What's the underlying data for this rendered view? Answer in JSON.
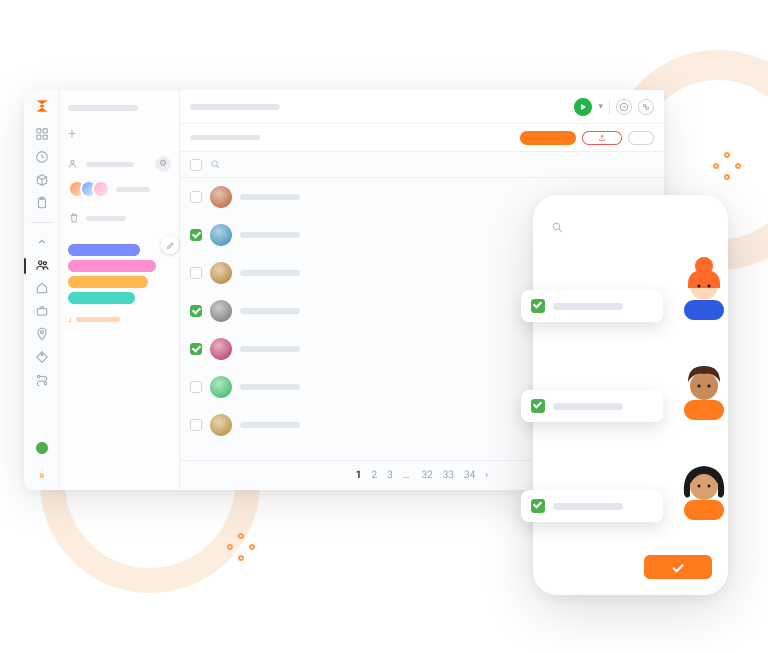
{
  "rail": {
    "logo": "S",
    "icons": [
      "dashboard",
      "clock",
      "cube",
      "clipboard",
      "chevron-up",
      "users",
      "home",
      "briefcase",
      "location",
      "tag",
      "route"
    ],
    "active_index": 5
  },
  "leftcol": {
    "sections": [
      {
        "icon": "user-group",
        "label": ""
      },
      {
        "icon": "trash",
        "label": ""
      }
    ],
    "avatars_count": 3,
    "tags": [
      {
        "color": "#7b8cff"
      },
      {
        "color": "#ff8fcf"
      },
      {
        "color": "#ffb84f"
      },
      {
        "color": "#46d6c4"
      }
    ],
    "sort_label": ""
  },
  "toolbar": {
    "title_placeholder": "",
    "buttons": {
      "play": "",
      "history": "",
      "settings": ""
    }
  },
  "subtoolbar": {
    "crumb": "",
    "primary_label": "",
    "share_label": "",
    "more_label": ""
  },
  "list": {
    "search_placeholder": "",
    "rows": [
      {
        "checked": false,
        "name": "",
        "hue": 20
      },
      {
        "checked": true,
        "name": "",
        "hue": 200
      },
      {
        "checked": false,
        "name": "",
        "hue": 35
      },
      {
        "checked": true,
        "name": "",
        "hue": 0,
        "grey": true
      },
      {
        "checked": true,
        "name": "",
        "hue": 340
      },
      {
        "checked": false,
        "name": "",
        "hue": 140
      },
      {
        "checked": false,
        "name": "",
        "hue": 40
      }
    ]
  },
  "pagination": {
    "pages_start": [
      "1",
      "2",
      "3"
    ],
    "pages_end": [
      "32",
      "33",
      "34"
    ],
    "ellipsis": "…",
    "current": "1"
  },
  "phone": {
    "search_placeholder": "",
    "people": [
      {
        "hair": "#ff6a2b",
        "skin": "#ffd8b8",
        "shirt": "#2e5be0"
      },
      {
        "hair": "#4a2a18",
        "skin": "#c98a5c",
        "shirt": "#ff7a1a"
      },
      {
        "hair": "#1a1a1a",
        "skin": "#d9a06e",
        "shirt": "#ff7a1a"
      }
    ]
  }
}
